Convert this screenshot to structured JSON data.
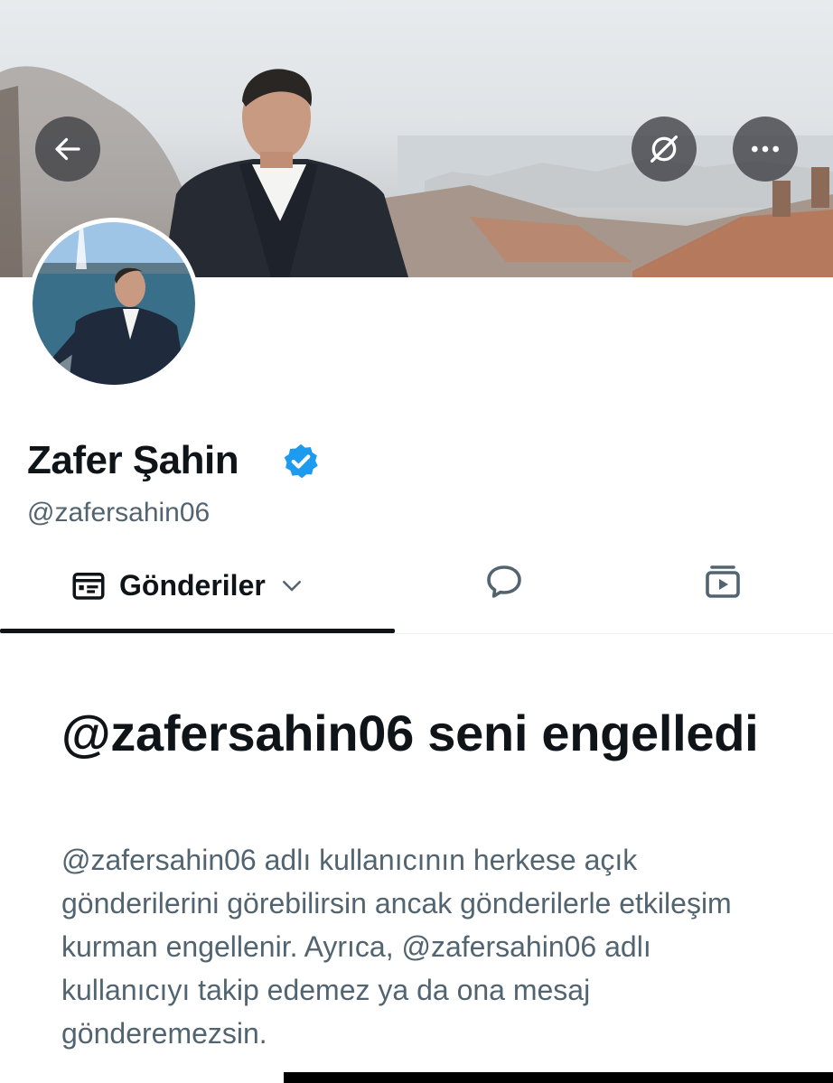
{
  "profile": {
    "display_name": "Zafer Şahin",
    "handle": "@zafersahin06",
    "verified": true
  },
  "icons": {
    "back": "back-arrow-icon",
    "translate": "translate-off-icon",
    "more": "more-horizontal-icon",
    "posts": "posts-list-icon",
    "replies": "reply-bubble-icon",
    "media": "media-play-icon",
    "verified": "verified-badge-icon"
  },
  "tabs": {
    "posts_label": "Gönderiler"
  },
  "blocked": {
    "title": "@zafersahin06 seni engelledi",
    "description": "@zafersahin06 adlı kullanıcının herkese açık gönderilerini görebilirsin ancak gönderilerle etkileşim kurman engellenir. Ayrıca, @zafersahin06 adlı kullanıcıyı takip edemez ya da ona mesaj gönderemezsin."
  },
  "colors": {
    "text_primary": "#0f1419",
    "text_secondary": "#536471",
    "verified_blue": "#1d9bf0",
    "overlay_button": "#3c3e42"
  }
}
